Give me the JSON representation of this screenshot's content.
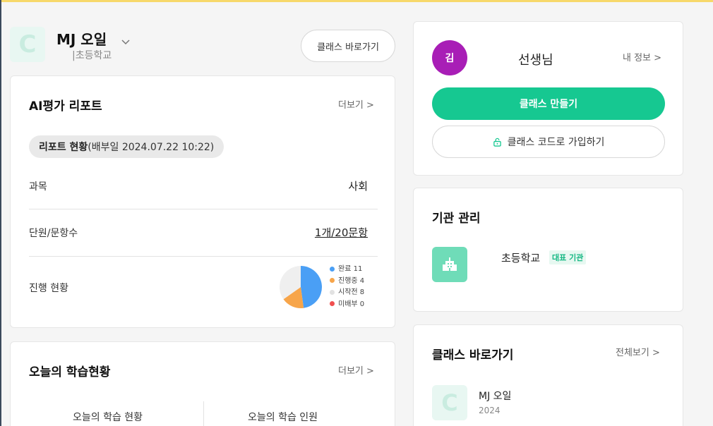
{
  "header": {
    "logo_letter": "C",
    "class_name": "MJ 오일",
    "school": "|초등학교",
    "shortcut_button": "클래스 바로가기"
  },
  "ai_report": {
    "title": "AI평가 리포트",
    "more": "더보기 >",
    "status_label": "리포트 현황",
    "status_date": "(배부일 2024.07.22 10:22)",
    "rows": [
      {
        "label": "과목",
        "value": "사회"
      },
      {
        "label": "단원/문항수",
        "value": "1개/20문항"
      },
      {
        "label": "진행 현황",
        "value": ""
      }
    ],
    "progress": [
      {
        "label": "완료 11",
        "count": 11,
        "color": "#4a9ff5"
      },
      {
        "label": "진행중 4",
        "count": 4,
        "color": "#f7a54a"
      },
      {
        "label": "시작전 8",
        "count": 8,
        "color": "#efefef"
      },
      {
        "label": "미배부 0",
        "count": 0,
        "color": "#f04f4f"
      }
    ]
  },
  "today": {
    "title": "오늘의 학습현황",
    "more": "더보기 >",
    "col1": "오늘의 학습 현황",
    "col2": "오늘의 학습 인원"
  },
  "profile": {
    "avatar_text": "김",
    "name": "선생님",
    "my_info": "내 정보 >",
    "make_class": "클래스 만들기",
    "join_class": "클래스 코드로 가입하기"
  },
  "institution": {
    "title": "기관 관리",
    "name": "초등학교",
    "badge": "대표 기관"
  },
  "class_shortcut": {
    "title": "클래스 바로가기",
    "view_all": "전체보기 >",
    "item_logo": "C",
    "item_name": "MJ 오일",
    "item_year": "2024"
  }
}
